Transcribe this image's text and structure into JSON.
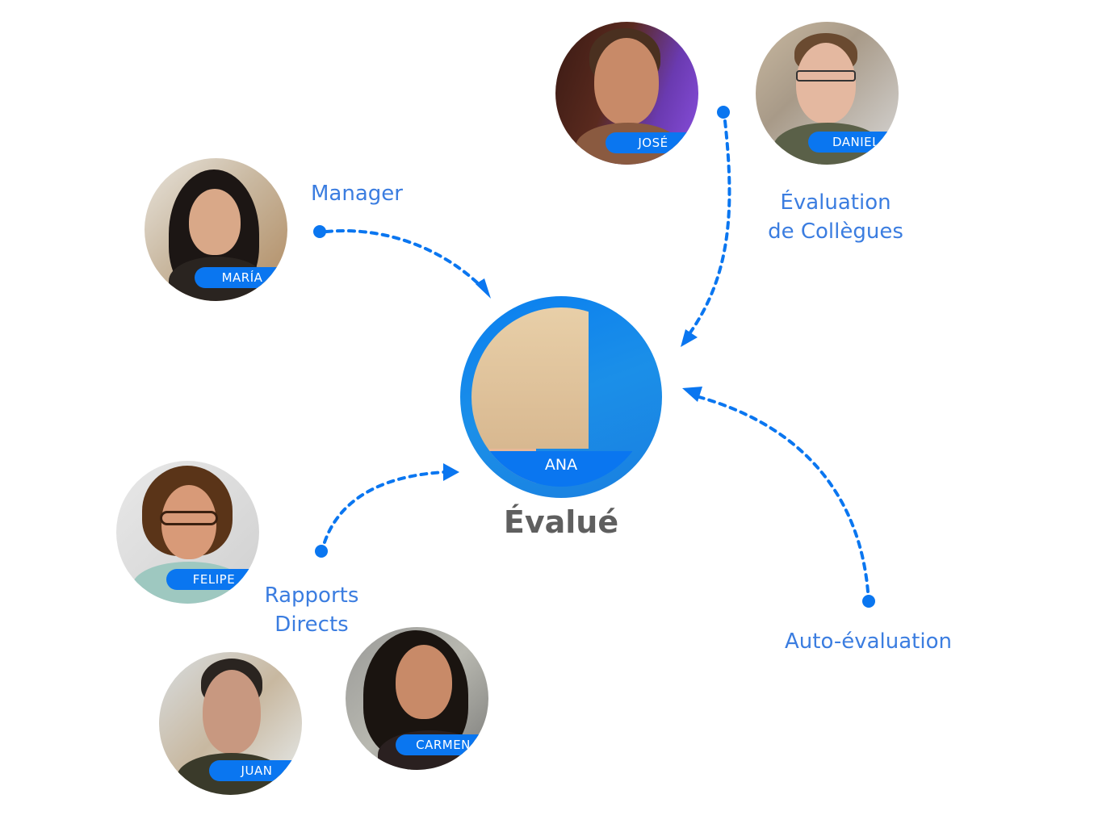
{
  "colors": {
    "accent": "#0a76f0",
    "label_text": "#3b7de0",
    "title_text": "#5f5f5f",
    "background": "#ffffff"
  },
  "center": {
    "name": "ANA",
    "title": "Évalué"
  },
  "groups": {
    "manager": {
      "label": "Manager",
      "people": [
        {
          "name": "MARÍA"
        }
      ]
    },
    "peers": {
      "label_line1": "Évaluation",
      "label_line2": "de Collègues",
      "people": [
        {
          "name": "JOSÉ"
        },
        {
          "name": "DANIEL"
        }
      ]
    },
    "direct_reports": {
      "label_line1": "Rapports",
      "label_line2": "Directs",
      "people": [
        {
          "name": "FELIPE"
        },
        {
          "name": "JUAN"
        },
        {
          "name": "CARMEN"
        }
      ]
    },
    "self": {
      "label": "Auto-évaluation"
    }
  }
}
